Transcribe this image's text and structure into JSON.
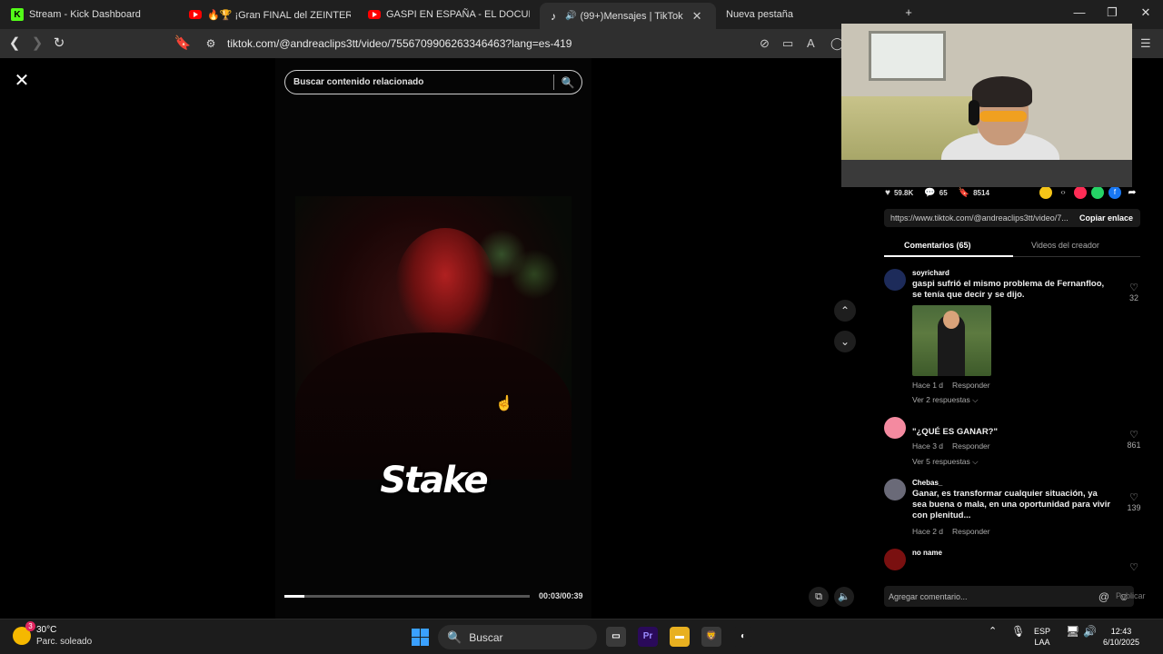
{
  "browser": {
    "tabs": [
      {
        "label": "Stream - Kick Dashboard",
        "icon": "kick-icon"
      },
      {
        "label": "🔥🏆 ¡Gran FINAL del ZEINTERNAC",
        "icon": "youtube-icon"
      },
      {
        "label": "GASPI EN ESPAÑA - EL DOCUMENTA",
        "icon": "youtube-icon"
      },
      {
        "label": "(99+)Mensajes | TikTok",
        "icon": "tiktok-icon",
        "active": true
      },
      {
        "label": "Nueva pestaña"
      }
    ],
    "url": "tiktok.com/@andreaclips3tt/video/7556709906263346463?lang=es-419"
  },
  "player": {
    "search_placeholder": "Buscar contenido relacionado",
    "logo_text": "Stake",
    "timecode": "00:03/00:39",
    "progress": 0.08
  },
  "side": {
    "stats": {
      "likes": "59.8K",
      "comments": "65",
      "saves": "8514"
    },
    "link": "https://www.tiktok.com/@andreaclips3tt/video/7...",
    "copy_label": "Copiar enlace",
    "tab_comments": "Comentarios (65)",
    "tab_creator": "Videos del creador",
    "comments": [
      {
        "user": "soyrichard",
        "text": "gaspi sufrió el mismo problema de Fernanfloo, se tenía que decir y se dijo.",
        "time": "Hace 1 d",
        "reply": "Responder",
        "more": "Ver 2 respuestas ⌵",
        "likes": "32"
      },
      {
        "user": "",
        "text": "\"¿QUÉ ES GANAR?\"",
        "time": "Hace 3 d",
        "reply": "Responder",
        "more": "Ver 5 respuestas ⌵",
        "likes": "861"
      },
      {
        "user": "Chebas_",
        "text": "Ganar, es transformar cualquier situación, ya sea buena o mala, en una oportunidad para vivir con plenitud...",
        "time": "Hace 2 d",
        "reply": "Responder",
        "likes": "139"
      },
      {
        "user": "no name",
        "text": "",
        "likes": ""
      }
    ],
    "input_placeholder": "Agregar comentario...",
    "publish_label": "Publicar"
  },
  "taskbar": {
    "temp": "30°C",
    "weather": "Parc. soleado",
    "badge": "3",
    "search": "Buscar",
    "lang1": "ESP",
    "lang2": "LAA",
    "time": "12:43",
    "date": "6/10/2025"
  }
}
